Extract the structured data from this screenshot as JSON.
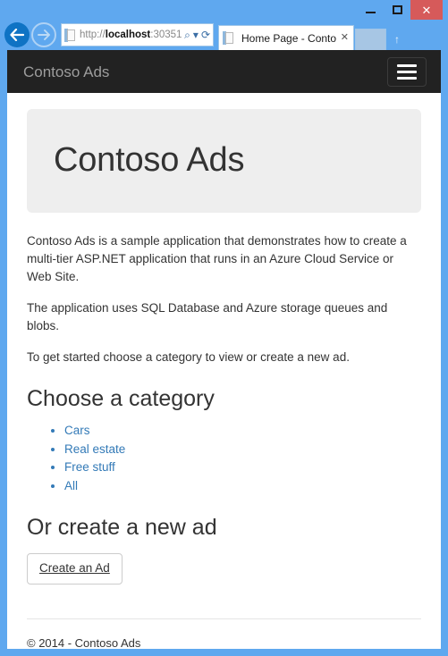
{
  "browser": {
    "back_icon": "back-arrow-icon",
    "forward_icon": "forward-arrow-icon",
    "url_prefix": "http://",
    "url_host": "localhost",
    "url_suffix": ":30351,",
    "search_icon": "⌕",
    "dropdown_icon": "▾",
    "refresh_icon": "⟳",
    "tab_title": "Home Page - Contoso...",
    "tab_close_icon": "✕",
    "newtab_icon": "↑",
    "minimize_label": "",
    "maximize_label": "",
    "close_label": "✕"
  },
  "navbar": {
    "brand": "Contoso Ads",
    "toggle_name": "hamburger-menu-icon"
  },
  "jumbotron": {
    "heading": "Contoso Ads"
  },
  "main": {
    "paragraphs": [
      "Contoso Ads is a sample application that demonstrates how to create a multi-tier ASP.NET application that runs in an Azure Cloud Service or Web Site.",
      "The application uses SQL Database and Azure storage queues and blobs.",
      "To get started choose a category to view or create a new ad."
    ],
    "category_heading": "Choose a category",
    "categories": [
      {
        "label": "Cars"
      },
      {
        "label": "Real estate"
      },
      {
        "label": "Free stuff"
      },
      {
        "label": "All"
      }
    ],
    "create_heading": "Or create a new ad",
    "create_button": "Create an Ad"
  },
  "footer": {
    "copyright": "© 2014 - Contoso Ads"
  },
  "colors": {
    "window_border": "#5fa8ef",
    "navbar_bg": "#222222",
    "brand_text": "#9d9d9d",
    "jumbotron_bg": "#eeeeee",
    "link": "#337ab7",
    "body_text": "#333333",
    "close_button": "#d65a5a"
  }
}
